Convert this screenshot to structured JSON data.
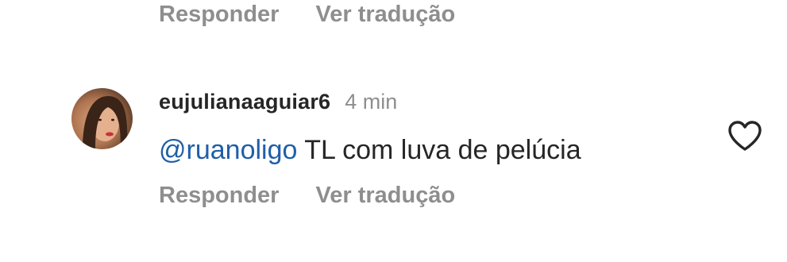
{
  "previous_comment": {
    "reply_label": "Responder",
    "translate_label": "Ver tradução"
  },
  "comment": {
    "username": "eujulianaaguiar6",
    "time": "4 min",
    "mention": "@ruanoligo",
    "text": " TL com luva de pelúcia",
    "reply_label": "Responder",
    "translate_label": "Ver tradução",
    "like_icon": "heart-outline-icon"
  },
  "colors": {
    "muted": "#8e8e8e",
    "text": "#262626",
    "mention": "#1f5fa8"
  }
}
